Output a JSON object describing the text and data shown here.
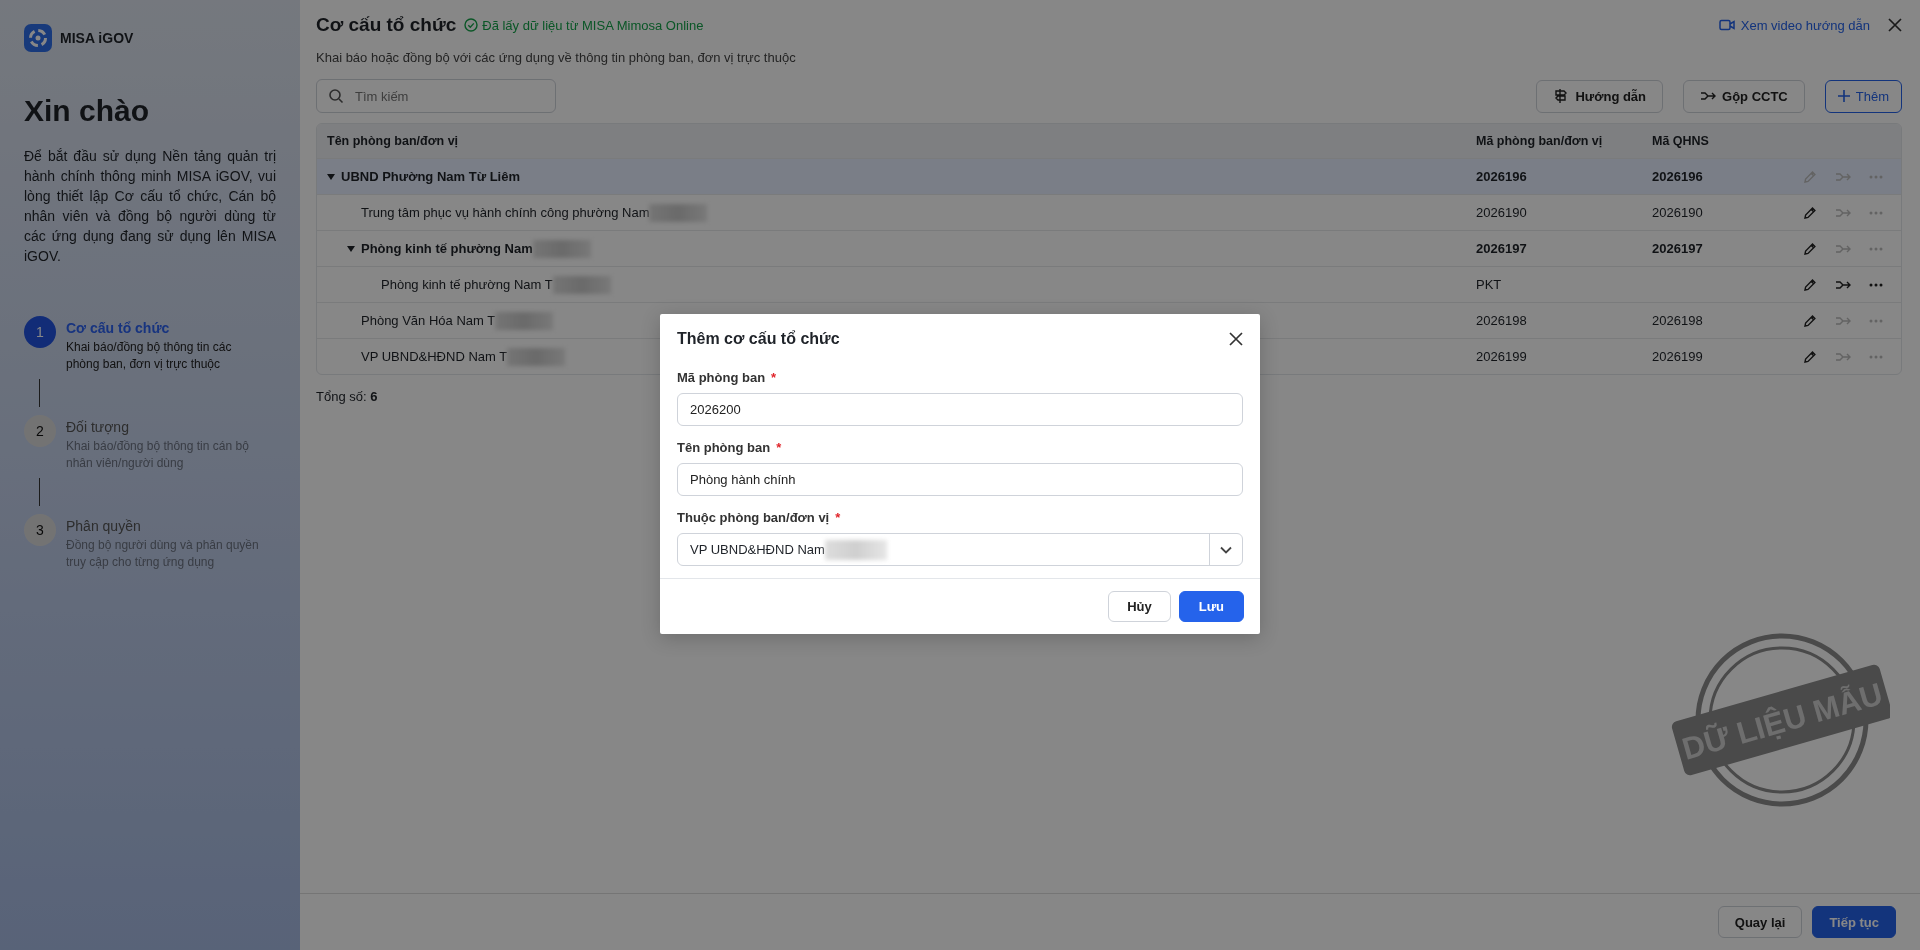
{
  "sidebar": {
    "brand": "MISA iGOV",
    "greeting": "Xin chào",
    "intro": "Để bắt đầu sử dụng Nền tảng quản trị hành chính thông minh MISA iGOV, vui lòng thiết lập Cơ cấu tổ chức, Cán bộ nhân viên và đồng bộ người dùng từ các ứng dụng đang sử dụng lên MISA iGOV.",
    "steps": [
      {
        "number": "1",
        "title": "Cơ cấu tổ chức",
        "description": "Khai báo/đồng bộ thông tin các phòng ban, đơn vị trực thuộc",
        "selected": true
      },
      {
        "number": "2",
        "title": "Đối tượng",
        "description": "Khai báo/đồng bộ thông tin cán bộ nhân viên/người dùng",
        "selected": false
      },
      {
        "number": "3",
        "title": "Phân quyền",
        "description": "Đồng bộ người dùng và phân quyền truy cập cho từng ứng dụng",
        "selected": false
      }
    ]
  },
  "header": {
    "title": "Cơ cấu tổ chức",
    "sync_status": "Đã lấy dữ liệu từ MISA Mimosa Online",
    "subtitle": "Khai báo hoặc đồng bộ với các ứng dụng về thông tin phòng ban, đơn vị trực thuộc",
    "video_link": "Xem video hướng dẫn"
  },
  "toolbar": {
    "search_placeholder": "Tìm kiếm",
    "buttons": [
      {
        "kind": "guide",
        "label": "Hướng dẫn"
      },
      {
        "kind": "merge",
        "label": "Gộp CCTC"
      },
      {
        "kind": "add",
        "label": "Thêm"
      }
    ]
  },
  "table": {
    "columns": [
      "Tên phòng ban/đơn vị",
      "Mã phòng ban/đơn vị",
      "Mã QHNS"
    ],
    "rows": [
      {
        "name": "UBND Phường Nam Từ Liêm",
        "code": "2026196",
        "qhns": "2026196",
        "redacted": false,
        "selected": true,
        "expanded": true,
        "edit_disabled": true,
        "merge_disabled": true,
        "more_disabled": true,
        "children": [
          {
            "name": "Trung tâm phục vụ hành chính công phường Nam",
            "code": "2026190",
            "qhns": "2026190",
            "redacted": true,
            "selected": false,
            "edit_disabled": false,
            "merge_disabled": true,
            "more_disabled": true
          },
          {
            "name": "Phòng kinh tế phường Nam",
            "code": "2026197",
            "qhns": "2026197",
            "redacted": true,
            "selected": false,
            "expanded": true,
            "edit_disabled": false,
            "merge_disabled": true,
            "more_disabled": true,
            "children": [
              {
                "name": "Phòng kinh tế phường Nam T",
                "code": "PKT",
                "redacted": true,
                "selected": false,
                "edit_disabled": false,
                "merge_disabled": false,
                "more_disabled": false
              }
            ]
          },
          {
            "name": "Phòng Văn Hóa Nam T",
            "code": "2026198",
            "qhns": "2026198",
            "redacted": true,
            "selected": false,
            "edit_disabled": false,
            "merge_disabled": true,
            "more_disabled": true
          },
          {
            "name": "VP UBND&HĐND Nam T",
            "code": "2026199",
            "qhns": "2026199",
            "redacted": true,
            "selected": false,
            "edit_disabled": false,
            "merge_disabled": true,
            "more_disabled": true
          }
        ]
      }
    ],
    "total_label": "Tổng số:",
    "total": "6"
  },
  "footer": {
    "back": "Quay lại",
    "next": "Tiếp tục"
  },
  "stamp": {
    "text": "DỮ LIỆU MẪU"
  },
  "dialog": {
    "title": "Thêm cơ cấu tổ chức",
    "fields": [
      {
        "kind": "text",
        "label": "Mã phòng ban",
        "required_mark": "*",
        "value": "2026200"
      },
      {
        "kind": "text",
        "label": "Tên phòng ban",
        "required_mark": "*",
        "value": "Phòng hành chính"
      },
      {
        "kind": "select",
        "label": "Thuộc phòng ban/đơn vị",
        "required_mark": "*",
        "value": "VP UBND&HĐND Nam",
        "redacted": true
      }
    ],
    "cancel": "Hủy",
    "save": "Lưu"
  }
}
